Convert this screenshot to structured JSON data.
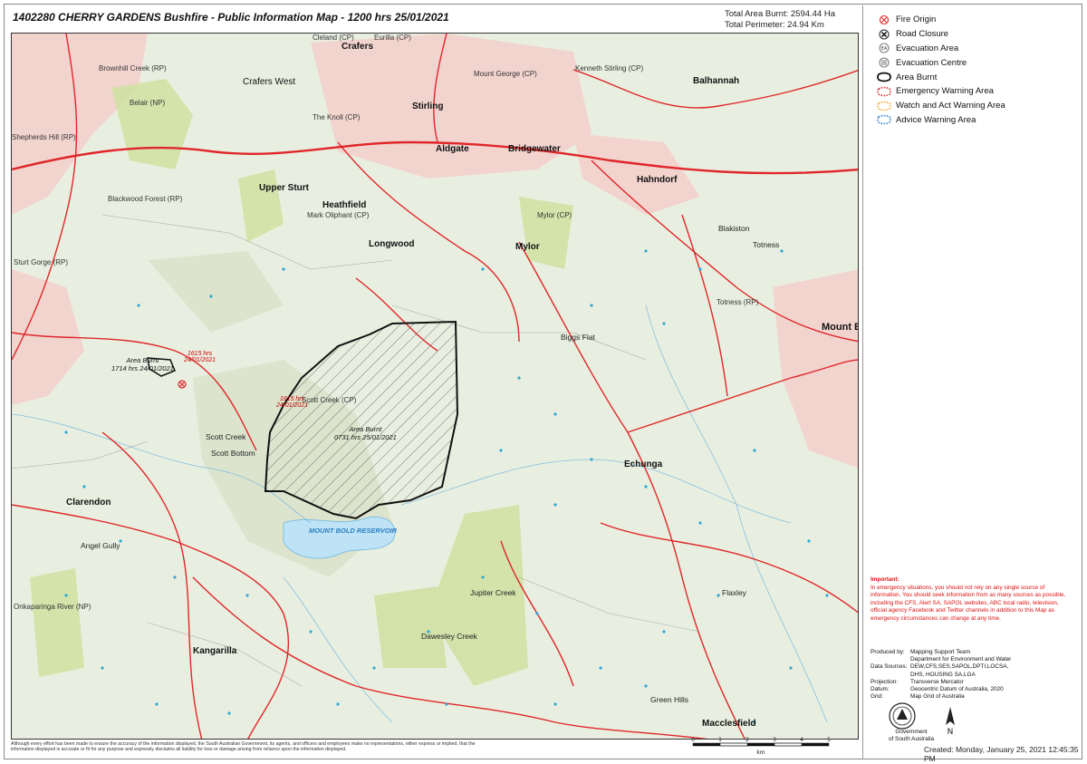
{
  "header": {
    "title": "1402280 CHERRY GARDENS Bushfire - Public Information Map - 1200 hrs 25/01/2021",
    "total_area": "Total Area Burnt: 2594.44 Ha",
    "total_perimeter": "Total Perimeter: 24.94 Km"
  },
  "legend": [
    {
      "icon": "fire-origin-icon",
      "label": "Fire Origin"
    },
    {
      "icon": "road-closure-icon",
      "label": "Road Closure"
    },
    {
      "icon": "evacuation-area-icon",
      "label": "Evacuation Area"
    },
    {
      "icon": "evacuation-centre-icon",
      "label": "Evacuation Centre"
    },
    {
      "icon": "area-burnt-icon",
      "label": "Area Burnt"
    },
    {
      "icon": "emergency-warning-icon",
      "label": "Emergency Warning Area"
    },
    {
      "icon": "watch-act-icon",
      "label": "Watch and Act Warning Area"
    },
    {
      "icon": "advice-warning-icon",
      "label": "Advice Warning Area"
    }
  ],
  "colors": {
    "road": "#e0262a",
    "burnt_outline": "#111111",
    "water": "#bfe3f6",
    "park": "#c8dc8a",
    "urban": "#f5c6c2",
    "important": "#d11111"
  },
  "map_labels": {
    "towns": [
      "Crafers",
      "Crafers West",
      "Stirling",
      "Aldgate",
      "Bridgewater",
      "Balhannah",
      "Hahndorf",
      "Upper Sturt",
      "Heathfield",
      "Longwood",
      "Mylor",
      "Echunga",
      "Mount Barker",
      "Clarendon",
      "Kangarilla",
      "Macclesfield",
      "Biggs Flat",
      "Scott Creek",
      "Scott Bottom",
      "Angel Gully",
      "Green Hills",
      "Totness",
      "Blakiston",
      "Flaxley",
      "Jupiter Creek",
      "Dawesley Creek"
    ],
    "parks": [
      "Cleland (CP)",
      "Eurilla (CP)",
      "Kenneth Stirling (CP)",
      "Brownhill Creek (RP)",
      "Belair (NP)",
      "Shepherds Hill (RP)",
      "Blackwood Forest (RP)",
      "Sturt Gorge (RP)",
      "Mount George (CP)",
      "The Knoll (CP)",
      "Mark Oliphant (CP)",
      "Mylor (CP)",
      "Onkaparinga River (NP)",
      "Totness (RP)",
      "Scott Creek (CP)"
    ],
    "water": "MOUNT BOLD RESERVOIR"
  },
  "annotations": {
    "burnt1_text": "Area Burnt",
    "burnt1_time": "1714 hrs 24/01/2021",
    "origin1_time": "1615 hrs",
    "origin1_date": "24/01/2021",
    "origin2_time": "1615 hrs",
    "origin2_date": "24/01/2021",
    "burnt2_text": "Area Burnt",
    "burnt2_time": "0731 hrs 25/01/2021"
  },
  "important": {
    "head": "Important:",
    "text": "In emergency situations, you should not rely on any single source of information. You should seek information from as many sources as possible, including the CFS, Alert SA, SAPOL websites, ABC local radio, television, official agency Facebook and Twitter channels in addition to this Map as emergency circumstances can change at any time."
  },
  "metadata": [
    {
      "key": "Produced by:",
      "value": "Mapping Support Team"
    },
    {
      "key": "",
      "value": "Department for Environment and Water"
    },
    {
      "key": "Data Sources:",
      "value": "DEW,CFS,SES,SAPOL,DPTI,LOCSA,"
    },
    {
      "key": "",
      "value": "DHS, HOUSING SA,LGA"
    },
    {
      "key": "Projection:",
      "value": "Transverse Mercator"
    },
    {
      "key": "Datum:",
      "value": "Geocentric Datum of Australia, 2020"
    },
    {
      "key": "Grid:",
      "value": "Map Grid of Australia"
    }
  ],
  "logo": {
    "line1": "Government",
    "line2": "of South Australia"
  },
  "north_label": "N",
  "scale": {
    "ticks": [
      "0",
      "1",
      "2",
      "3",
      "4",
      "5"
    ],
    "unit": "km"
  },
  "created": "Created: Monday, January 25, 2021 12:45:35 PM",
  "disclaimer": "Although every effort has been made to ensure the accuracy of the information displayed, the South Australian Government, its agents, and officers and employees make no representations, either express or implied, that the information displayed is accurate or fit for any purpose and expressly disclaims all liability for loss or damage arising from reliance upon the information displayed."
}
